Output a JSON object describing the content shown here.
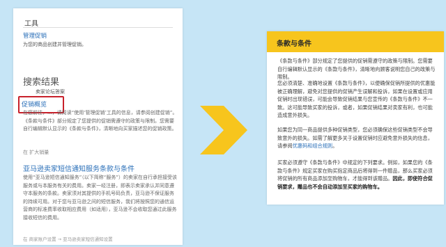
{
  "left_panel": {
    "tools_heading": "工具",
    "tools_link": "管理促销",
    "tools_desc": "为您的商品创建并管理促销。",
    "search_heading": "搜索结果",
    "search_tag": "卖家论坛答案",
    "result1": {
      "title": "促销概览",
      "text": "在您前往，...，请阅读“使用‘管理促销’工具的信息，请参阅创建促销”。《条款与条件》部分规定了您提供的促销需遵守的政策与限制。您需要自行编辑默认显示的《条款与条件》，清晰地向买家描述您的促销政策。",
      "link": "在 扩大销量"
    },
    "result2": {
      "title": "亚马逊卖家短信通知服务条款与条件",
      "text": "使用“亚马逊短信通知服务”（以下简称“服务”）的卖家在自行承担接受该服务或与本服务有关的费用。卖家一经注册，即表示卖家承认并同意遵守本服务的条款。卖家须对其提供的手机号码负责，亚马逊不保证服务的持续可用。对于您与亚马逊之间的短信服务，我们将按照您的通信运营商的标准费率收取相应费用（如适用），亚马逊不会收取您通过此服务接收短信的费用。",
      "link": "在 商家账户设置 → 亚马逊卖家短信通知设置"
    }
  },
  "right_panel": {
    "title": "条款与条件",
    "p1": "《条款与条件》部分规定了您提供的促销需遵守的政策与限制。您需要自行编辑默认显示的《条款与条件》，清晰地向顾客说明您自己的政策与限制。",
    "p2": "您必须清楚、准确地设置《条款与条件》，以便确保促销所提供的优惠能被正确理解，避免对您提供的促销产生误解和投诉，如果在设置或应用促销时出现错误，可能会导致促销结果与您宣传的《条款与条件》不一致。这可能导致买家的投诉，或者，如果促销结果对卖家有利，也可能造成意外损失。",
    "p3_before": "如果您为同一商品提供多种促销类型，您必须确保这些促销类型不会导致意外的损失。如需了解更多关于设置促销时应避免意外损失的信息，请参阅",
    "p3_link": "优惠码和组合规则",
    "p3_after": "。",
    "p4_before": "买家必须遵守《条款与条件》中规定的下列要求。例如，如果您的《条款与条件》规定买家在购买指定商品后将得到一件赠品，那么买家必须将促销的所有商品添加至购物车，才能得到该赠品。",
    "p4_bold": "因此，即使符合促销要求，赠品也不会自动添加至买家的购物车。"
  },
  "colors": {
    "background": "#c6e5f6",
    "accent_yellow": "#f7c51d",
    "link_blue": "#2a6fb8",
    "highlight_red": "#c8202a"
  },
  "icons": {
    "arrow": "chevron-right-arrow-icon"
  }
}
